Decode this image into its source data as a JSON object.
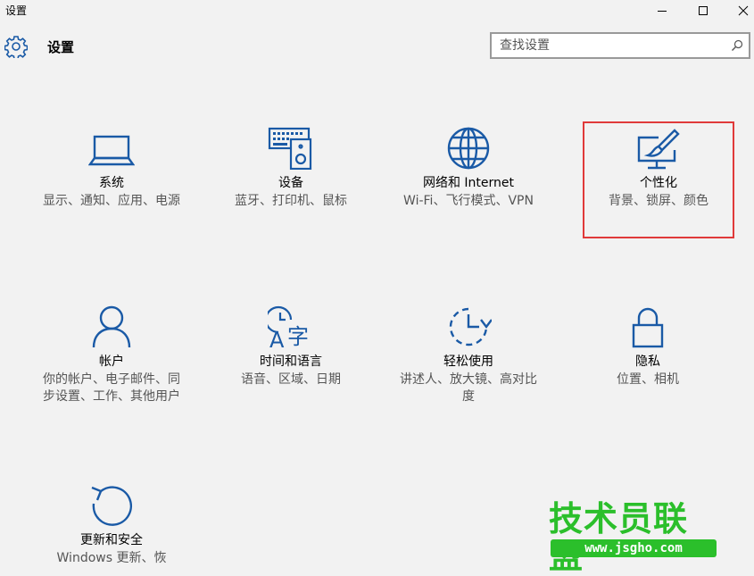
{
  "window": {
    "title": "设置",
    "controls": {
      "minimize": "minimize-icon",
      "maximize": "maximize-icon",
      "close": "close-icon"
    }
  },
  "header": {
    "icon": "gear-icon",
    "title": "设置",
    "search": {
      "placeholder": "查找设置",
      "value": "",
      "icon": "search-icon"
    }
  },
  "accent_color": "#1a5aa6",
  "selection_color": "#e03a3a",
  "tiles": [
    {
      "icon": "laptop-icon",
      "name": "系统",
      "desc": "显示、通知、应用、电源"
    },
    {
      "icon": "keyboard-speaker-icon",
      "name": "设备",
      "desc": "蓝牙、打印机、鼠标"
    },
    {
      "icon": "globe-icon",
      "name": "网络和 Internet",
      "desc": "Wi-Fi、飞行模式、VPN"
    },
    {
      "icon": "paintbrush-monitor-icon",
      "name": "个性化",
      "desc": "背景、锁屏、颜色",
      "highlighted": true
    },
    {
      "icon": "person-icon",
      "name": "帐户",
      "desc": "你的帐户、电子邮件、同步设置、工作、其他用户"
    },
    {
      "icon": "clock-language-icon",
      "name": "时间和语言",
      "desc": "语音、区域、日期"
    },
    {
      "icon": "ease-of-access-icon",
      "name": "轻松使用",
      "desc": "讲述人、放大镜、高对比度"
    },
    {
      "icon": "lock-icon",
      "name": "隐私",
      "desc": "位置、相机"
    },
    {
      "icon": "refresh-icon",
      "name": "更新和安全",
      "desc": "Windows 更新、恢"
    }
  ],
  "watermark": {
    "text": "技术员联盟",
    "url": "www.jsgho.com"
  }
}
